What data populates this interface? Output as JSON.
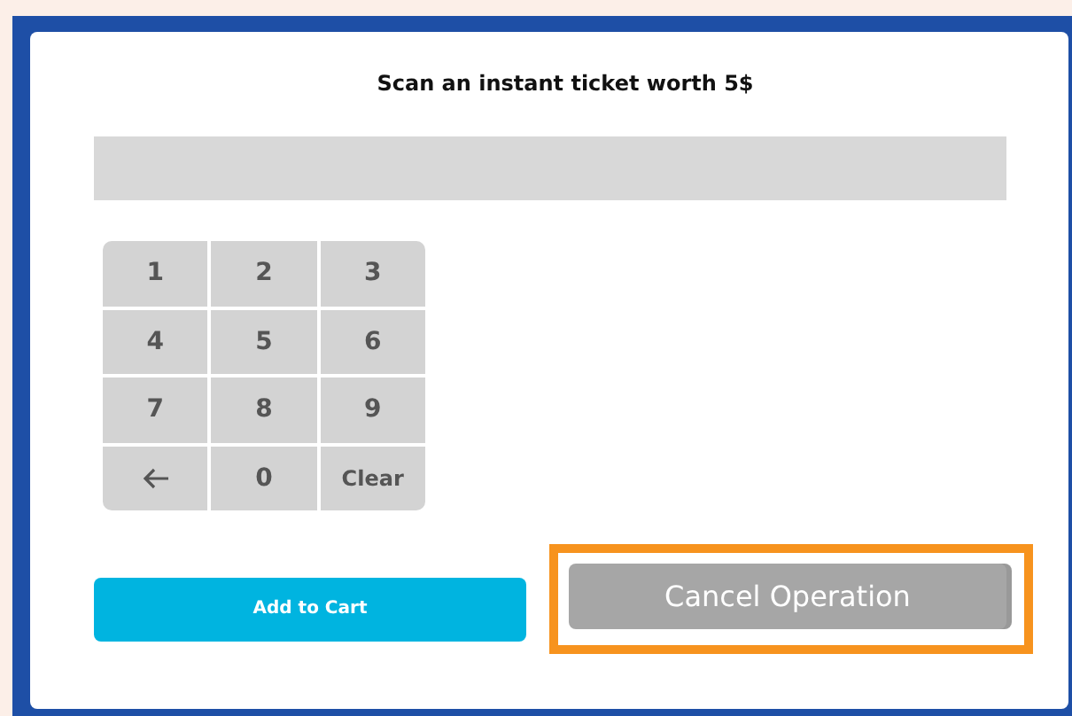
{
  "title": "Scan an instant ticket worth 5$",
  "keypad": [
    {
      "kind": "digit",
      "label": "1"
    },
    {
      "kind": "digit",
      "label": "2"
    },
    {
      "kind": "digit",
      "label": "3"
    },
    {
      "kind": "digit",
      "label": "4"
    },
    {
      "kind": "digit",
      "label": "5"
    },
    {
      "kind": "digit",
      "label": "6"
    },
    {
      "kind": "digit",
      "label": "7"
    },
    {
      "kind": "digit",
      "label": "8"
    },
    {
      "kind": "digit",
      "label": "9"
    },
    {
      "kind": "backspace"
    },
    {
      "kind": "digit",
      "label": "0"
    },
    {
      "kind": "clear",
      "label": "Clear"
    }
  ],
  "buttons": [
    {
      "kind": "primary",
      "label": "Add to Cart",
      "highlighted": false
    },
    {
      "kind": "secondary",
      "label": "Cancel Operation",
      "highlighted": true
    }
  ]
}
